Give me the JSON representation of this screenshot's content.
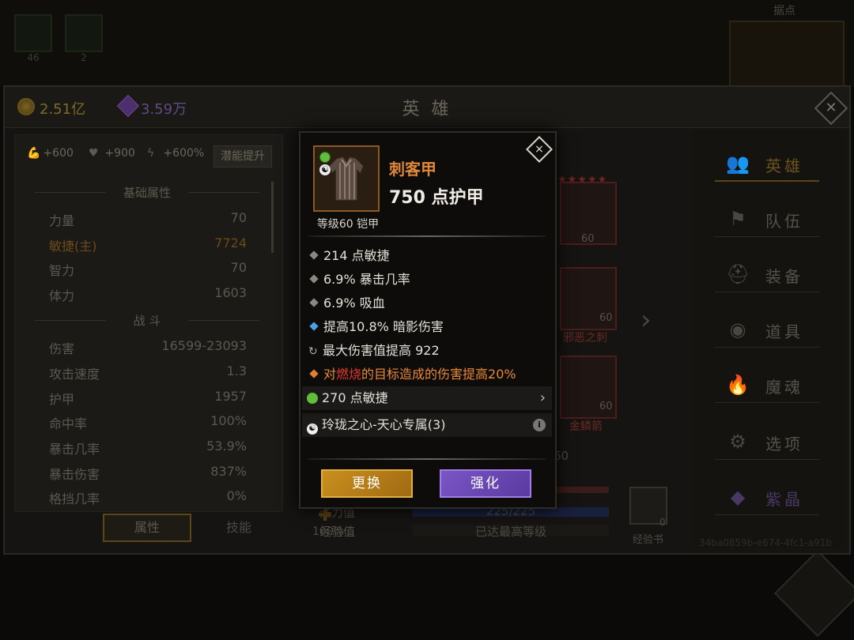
{
  "background": {
    "slots": [
      {
        "count": "46"
      },
      {
        "count": "2"
      }
    ],
    "top_right_title": "据点"
  },
  "header": {
    "gold": "2.51亿",
    "gems": "3.59万",
    "title": "英 雄"
  },
  "stats_panel": {
    "bonuses": {
      "strength": "+600",
      "hp": "+900",
      "speed": "+600%"
    },
    "potential_button": "潜能提升",
    "basic_title": "基础属性",
    "basic": [
      {
        "label": "力量",
        "value": "70",
        "main": false
      },
      {
        "label": "敏捷(主)",
        "value": "7724",
        "main": true
      },
      {
        "label": "智力",
        "value": "70",
        "main": false
      },
      {
        "label": "体力",
        "value": "1603",
        "main": false
      }
    ],
    "combat_title": "战 斗",
    "combat": [
      {
        "label": "伤害",
        "value": "16599-23093"
      },
      {
        "label": "攻击速度",
        "value": "1.3"
      },
      {
        "label": "护甲",
        "value": "1957"
      },
      {
        "label": "命中率",
        "value": "100%"
      },
      {
        "label": "暴击几率",
        "value": "53.9%"
      },
      {
        "label": "暴击伤害",
        "value": "837%"
      },
      {
        "label": "格挡几率",
        "value": "0%"
      }
    ],
    "tabs": {
      "attributes": "属性",
      "skills": "技能"
    }
  },
  "hero_area": {
    "stars": "★★★★★",
    "slot_top_level": "60",
    "slot_mid_level": "60",
    "slot_mid_name": "邪恶之刺",
    "slot_low_level": "60",
    "slot_low_name": "金鳞箭",
    "level_partial": "60",
    "mana_label": "法力值",
    "mana_value": "225/225",
    "exp_label": "经验值",
    "exp_value": "已达最高等级",
    "percent": "100%",
    "book_label": "经验书",
    "book_count": "0"
  },
  "nav": {
    "items": [
      {
        "label": "英雄",
        "icon": "people-icon"
      },
      {
        "label": "队伍",
        "icon": "flag-icon"
      },
      {
        "label": "装备",
        "icon": "helmet-icon"
      },
      {
        "label": "道具",
        "icon": "bag-icon"
      },
      {
        "label": "魔魂",
        "icon": "flame-icon"
      },
      {
        "label": "选项",
        "icon": "gear-icon"
      },
      {
        "label": "紫晶",
        "icon": "amethyst-icon"
      }
    ],
    "uid": "34ba0859b-e674-4fc1-a91b"
  },
  "item_popup": {
    "name": "刺客甲",
    "armor": "750 点护甲",
    "level": "等级60 铠甲",
    "close": "×",
    "affixes": [
      {
        "text": "214 点敏捷",
        "type": "normal"
      },
      {
        "text": "6.9% 暴击几率",
        "type": "normal"
      },
      {
        "text": "6.9% 吸血",
        "type": "normal"
      },
      {
        "text": "提高10.8% 暗影伤害",
        "type": "blue"
      },
      {
        "text": "最大伤害值提高 922",
        "type": "reroll"
      }
    ],
    "special_pre": "对",
    "special_red": "燃烧",
    "special_post": "的目标造成的伤害提高20%",
    "socket_text": "270 点敏捷",
    "set_text": "玲珑之心-天心专属(3)",
    "button_replace": "更换",
    "button_upgrade": "强化"
  },
  "colors": {
    "item_name": "#e0883a",
    "special_affix": "#e8883a",
    "burn_highlight": "#e03a2a",
    "replace_button": "#c9901e",
    "upgrade_button": "#7a56c6"
  }
}
